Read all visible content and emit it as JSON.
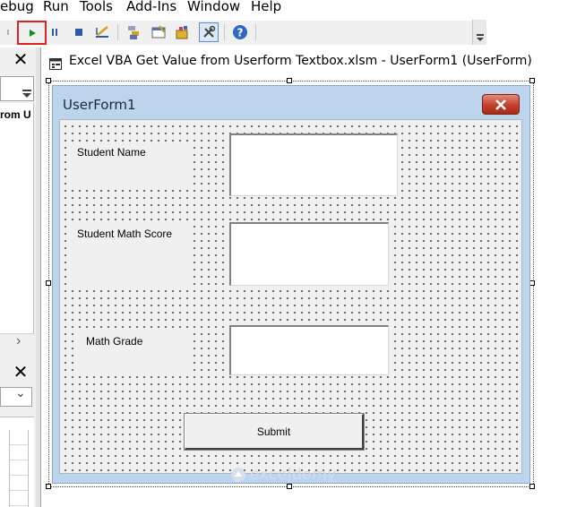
{
  "menu": {
    "items": [
      "ebug",
      "Run",
      "Tools",
      "Add-Ins",
      "Window",
      "Help"
    ]
  },
  "toolbar": {
    "buttons": [
      "run-sub-icon",
      "break-icon",
      "reset-icon",
      "design-mode-icon",
      "project-explorer-icon",
      "properties-window-icon",
      "object-browser-icon",
      "toolbox-icon",
      "help-icon"
    ],
    "highlight_color": "#e02020"
  },
  "left_pane": {
    "close_glyph": "✕",
    "project_text": "rom U",
    "scroll_arrow": "›",
    "combo_arrow": "⌄"
  },
  "window": {
    "title": "Excel VBA Get Value from Userform Textbox.xlsm - UserForm1 (UserForm)"
  },
  "userform": {
    "caption": "UserForm1",
    "close_color": "#c2402c",
    "labels": {
      "student_name": "Student Name",
      "math_score": "Student Math Score",
      "math_grade": "Math Grade"
    },
    "submit_label": "Submit"
  },
  "watermark": {
    "text": "exceldemy"
  }
}
